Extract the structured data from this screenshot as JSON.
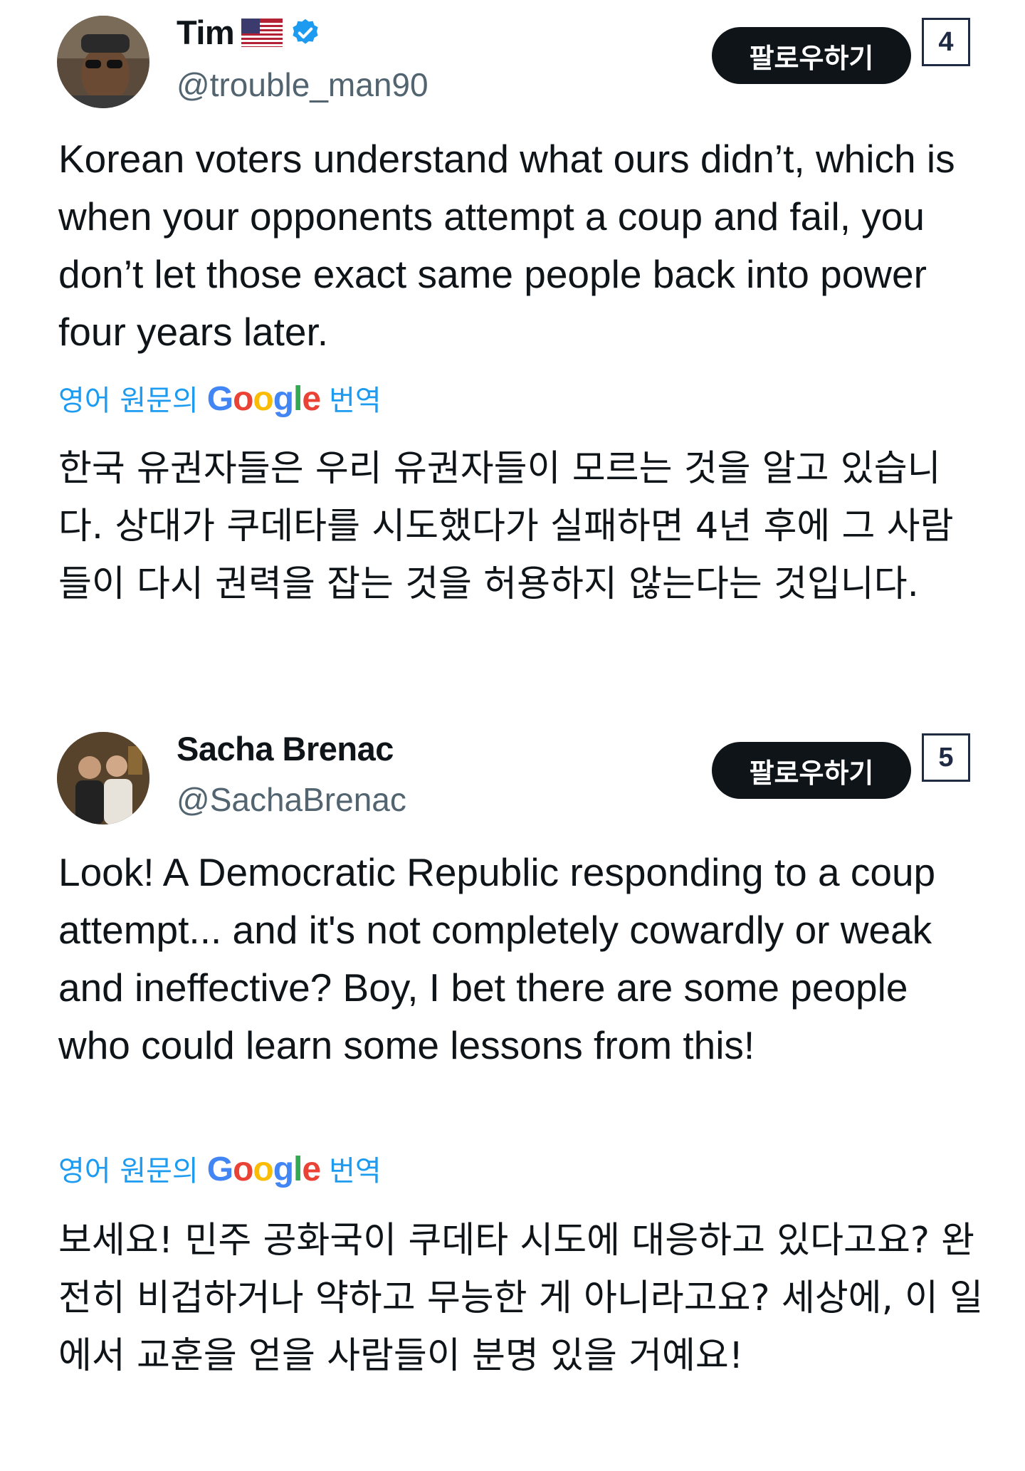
{
  "colors": {
    "link": "#1d9bf0",
    "text": "#0f1419",
    "secondary": "#536471",
    "button_bg": "#0f1419",
    "verified": "#1d9bf0"
  },
  "tweets": [
    {
      "number": "4",
      "display_name": "Tim",
      "flag_icon": "us-flag-icon",
      "verified": true,
      "handle": "@trouble_man90",
      "follow_label": "팔로우하기",
      "body_en": "Korean voters understand what ours didn’t, which is when your opponents attempt a coup and fail, you don’t let those exact same people back into power four years later.",
      "translate_prefix": "영어 원문의",
      "translate_brand": "Google",
      "translate_suffix": "번역",
      "body_ko": "한국 유권자들은 우리 유권자들이 모르는 것을 알고 있습니다. 상대가 쿠데타를 시도했다가 실패하면 4년 후에 그 사람들이 다시 권력을 잡는 것을 허용하지 않는다는 것입니다."
    },
    {
      "number": "5",
      "display_name": "Sacha Brenac",
      "handle": "@SachaBrenac",
      "follow_label": "팔로우하기",
      "body_en": "Look! A Democratic Republic responding to a coup attempt... and it's not completely cowardly or weak and ineffective? Boy, I bet there are some people who could learn some lessons from this!",
      "translate_prefix": "영어 원문의",
      "translate_brand": "Google",
      "translate_suffix": "번역",
      "body_ko": "보세요! 민주 공화국이 쿠데타 시도에 대응하고 있다고요? 완전히 비겁하거나 약하고 무능한 게 아니라고요? 세상에, 이 일에서 교훈을 얻을 사람들이 분명 있을 거예요!"
    }
  ]
}
